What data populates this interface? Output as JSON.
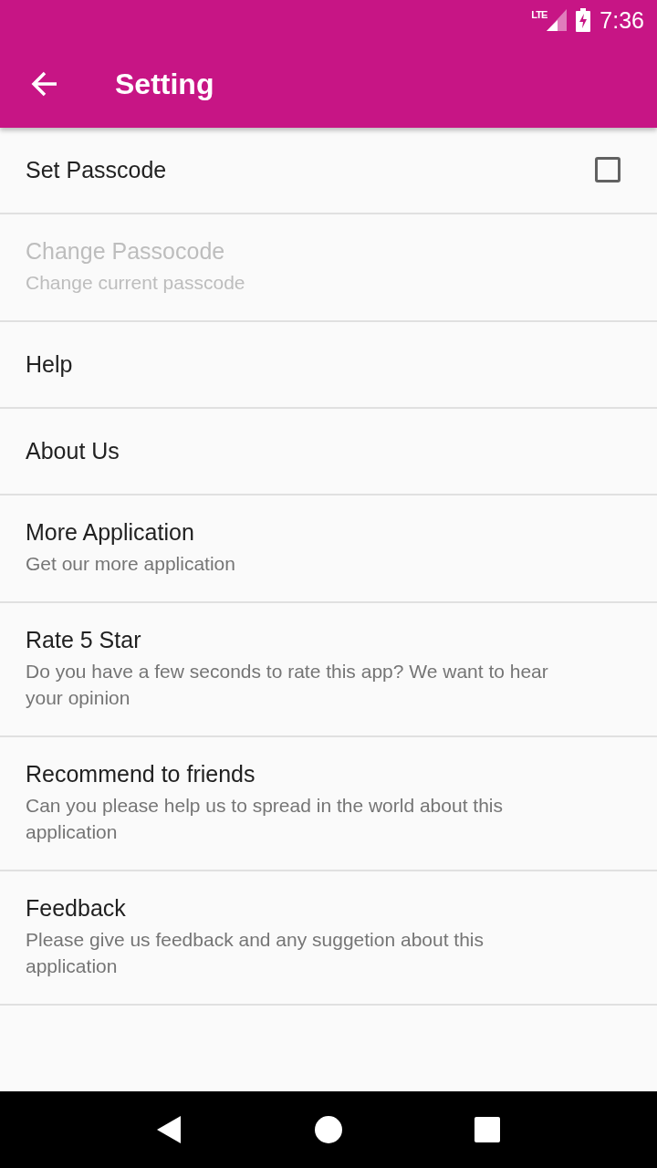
{
  "status_bar": {
    "network": "LTE",
    "time": "7:36"
  },
  "toolbar": {
    "title": "Setting"
  },
  "settings": [
    {
      "kind": "checkbox",
      "title": "Set Passcode",
      "checked": false,
      "disabled": false
    },
    {
      "kind": "plain",
      "title": "Change Passocode",
      "summary": "Change current passcode",
      "disabled": true
    },
    {
      "kind": "plain",
      "title": "Help",
      "disabled": false
    },
    {
      "kind": "plain",
      "title": "About Us",
      "disabled": false
    },
    {
      "kind": "plain",
      "title": "More Application",
      "summary": "Get our more application",
      "disabled": false
    },
    {
      "kind": "plain",
      "title": "Rate 5 Star",
      "summary": "Do you have a few seconds to rate this app? We want to hear your opinion",
      "disabled": false
    },
    {
      "kind": "plain",
      "title": "Recommend to friends",
      "summary": "Can you please help us to spread in the world about this application",
      "disabled": false
    },
    {
      "kind": "plain",
      "title": "Feedback",
      "summary": "Please give us feedback and any suggetion about this application",
      "disabled": false
    }
  ]
}
